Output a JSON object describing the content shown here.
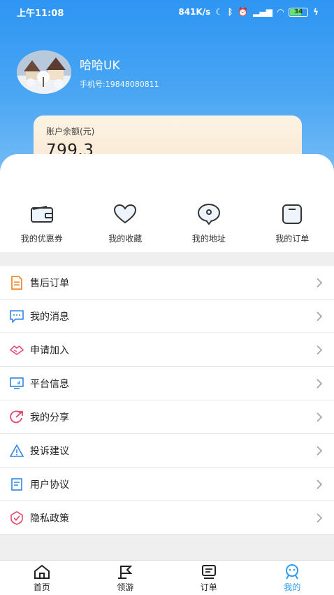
{
  "status_bar": {
    "time": "上午11:08",
    "network_speed": "841K/s",
    "battery": "34"
  },
  "profile": {
    "name": "哈哈UK",
    "phone": "手机号:19848080811"
  },
  "balance": {
    "label": "账户余额(元)",
    "value": "799.3"
  },
  "quick_actions": [
    {
      "label": "我的优惠券",
      "icon": "wallet-icon"
    },
    {
      "label": "我的收藏",
      "icon": "heart-icon"
    },
    {
      "label": "我的地址",
      "icon": "location-icon"
    },
    {
      "label": "我的订单",
      "icon": "order-icon"
    }
  ],
  "menu": [
    {
      "label": "售后订单",
      "icon": "document-icon",
      "color": "#f08a2e"
    },
    {
      "label": "我的消息",
      "icon": "message-icon",
      "color": "#2e86e8"
    },
    {
      "label": "申请加入",
      "icon": "handshake-icon",
      "color": "#e2456b"
    },
    {
      "label": "平台信息",
      "icon": "monitor-icon",
      "color": "#2e86e8"
    },
    {
      "label": "我的分享",
      "icon": "share-icon",
      "color": "#e2456b"
    },
    {
      "label": "投诉建议",
      "icon": "warning-icon",
      "color": "#2e86e8"
    },
    {
      "label": "用户协议",
      "icon": "agreement-icon",
      "color": "#2e86e8"
    },
    {
      "label": "隐私政策",
      "icon": "shield-icon",
      "color": "#e2456b"
    }
  ],
  "tabs": [
    {
      "label": "首页",
      "icon": "home-icon"
    },
    {
      "label": "领游",
      "icon": "flag-icon"
    },
    {
      "label": "订单",
      "icon": "receipt-icon"
    },
    {
      "label": "我的",
      "icon": "profile-icon",
      "active": true
    }
  ],
  "colors": {
    "accent": "#2e9bf0",
    "header_gradient_top": "#2e95f3",
    "card_gold": "#f7e7cf"
  }
}
